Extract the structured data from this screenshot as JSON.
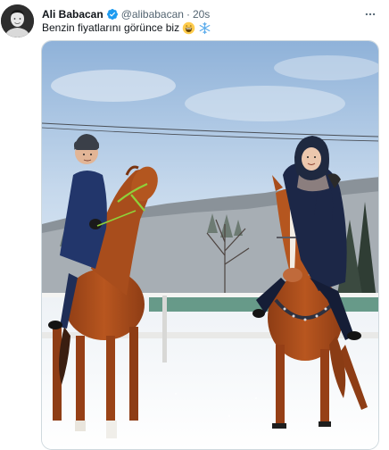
{
  "tweet": {
    "display_name": "Ali Babacan",
    "handle": "@alibabacan",
    "separator": "·",
    "time": "20s",
    "text": "Benzin fiyatlarını görünce biz",
    "emojis": [
      "grinning-face",
      "snowflake"
    ]
  },
  "colors": {
    "verified": "#1d9bf0",
    "secondary_text": "#536471",
    "primary_text": "#0f1419"
  }
}
